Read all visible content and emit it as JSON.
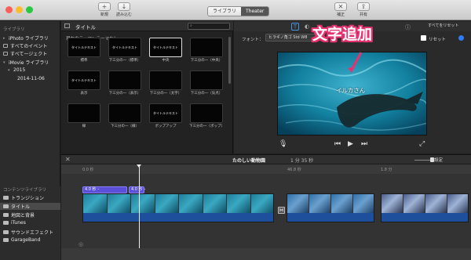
{
  "toolbar": {
    "import_new_label": "新規",
    "import_load_label": "読み込む",
    "enhance_label": "補正",
    "share_label": "共有",
    "tabs": [
      {
        "label": "ライブラリ",
        "active": false
      },
      {
        "label": "Theater",
        "active": true
      }
    ]
  },
  "library": {
    "header": "ライブラリ",
    "items": [
      {
        "label": "iPhoto ライブラリ"
      },
      {
        "label": "すべてのイベント"
      },
      {
        "label": "すべてージェクト"
      },
      {
        "label": "iMovie ライブラリ"
      },
      {
        "label": "2015"
      },
      {
        "label": "2014-11-06"
      }
    ]
  },
  "browser": {
    "title": "タイトル",
    "search_placeholder": "",
    "theme_text": "現在のテーマ：テーマなし",
    "tiles": [
      {
        "tile_text": "タイトルテキスト",
        "caption": "標準"
      },
      {
        "tile_text": "タイトルテキスト",
        "caption": "下三分の一（標準）"
      },
      {
        "tile_text": "タイトルテキスト",
        "caption": "中央"
      },
      {
        "tile_text": "",
        "caption": "下三分の一（中央）"
      },
      {
        "tile_text": "タイトルテキスト",
        "caption": "表示"
      },
      {
        "tile_text": "",
        "caption": "下三分の一（表示）"
      },
      {
        "tile_text": "",
        "caption": "下三分の一（太字）"
      },
      {
        "tile_text": "",
        "caption": "下三分の一（気点）"
      },
      {
        "tile_text": "",
        "caption": "線"
      },
      {
        "tile_text": "",
        "caption": "下三分の一（線）"
      },
      {
        "tile_text": "タイトルテキスト",
        "caption": "ポップアップ"
      },
      {
        "tile_text": "",
        "caption": "下三分の一（ポップ）"
      }
    ]
  },
  "viewer": {
    "reset_all_label": "すべてをリセット",
    "font_label": "フォント：",
    "font_value": "ヒラギノ角ゴ Std W8",
    "reset_label": "リセット",
    "video_title_text": "イルカさん",
    "annotation": "文字追加"
  },
  "timeline": {
    "project_title": "たのしい動物園",
    "duration": "1 分 35 秒",
    "settings_label": "設定",
    "timecodes": [
      "0.0 秒",
      "46.8 秒",
      "1.8 分"
    ],
    "title_clips": [
      "4.0 秒 – ",
      "4.0 秒 –"
    ]
  },
  "content_library": {
    "header": "コンテンツライブラリ",
    "items": [
      {
        "label": "トランジション"
      },
      {
        "label": "タイトル"
      },
      {
        "label": "地図と背景"
      },
      {
        "label": "iTunes"
      },
      {
        "label": "サウンドエフェクト"
      },
      {
        "label": "GarageBand"
      }
    ]
  },
  "colors": {
    "accent": "#2d7cf6",
    "annotation": "#e8326f",
    "title_clip": "#5a4fd6",
    "audio": "#1d4f9c"
  }
}
